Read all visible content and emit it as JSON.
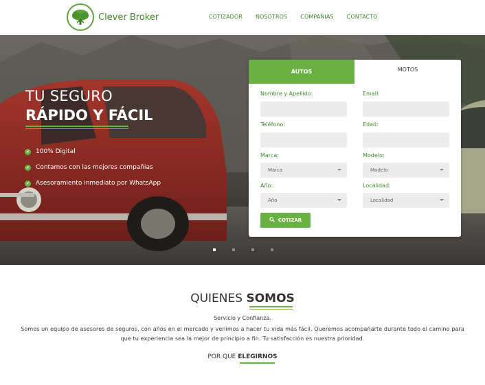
{
  "header": {
    "brand": "Clever Broker",
    "nav": [
      "COTIZADOR",
      "NOSOTROS",
      "COMPAÑIAS",
      "CONTACTO"
    ]
  },
  "hero": {
    "title_line1": "TU SEGURO",
    "title_line2": "RÁPIDO Y FÁCIL",
    "features": [
      "100% Digital",
      "Contamos con las mejores compañias",
      "Asesoramiento inmediato por WhatsApp"
    ],
    "slides_count": 4,
    "active_slide": 1
  },
  "form": {
    "tabs": [
      "AUTOS",
      "MOTOS"
    ],
    "active_tab": "AUTOS",
    "labels": {
      "nombre": "Nombre y Apellido:",
      "email": "Email:",
      "telefono": "Teléfono:",
      "edad": "Edad:",
      "marca": "Marca:",
      "modelo": "Modelo:",
      "anio": "Año:",
      "localidad": "Localidad:"
    },
    "selects": {
      "marca": "Marca",
      "modelo": "Modelo",
      "anio": "Año",
      "localidad": "Localidad"
    },
    "submit": "COTIZAR"
  },
  "about": {
    "title_plain": "QUIENES ",
    "title_bold": "SOMOS",
    "subtitle": "Servicio y Confianza.",
    "text": "Somos un equipo de asesores de seguros, con años en el mercado y venimos a hacer tu vida más fácil. Queremos acompañarte durante todo el camino para que tu experiencia sea la mejor de principio a fin. Tu satisfacción es nuestra prioridad.",
    "why_plain": "POR QUE ",
    "why_bold": "ELEGIRNOS"
  },
  "colors": {
    "accent": "#6ab143",
    "brand_text": "#3e8a2a",
    "car_red": "#8f2a22"
  }
}
